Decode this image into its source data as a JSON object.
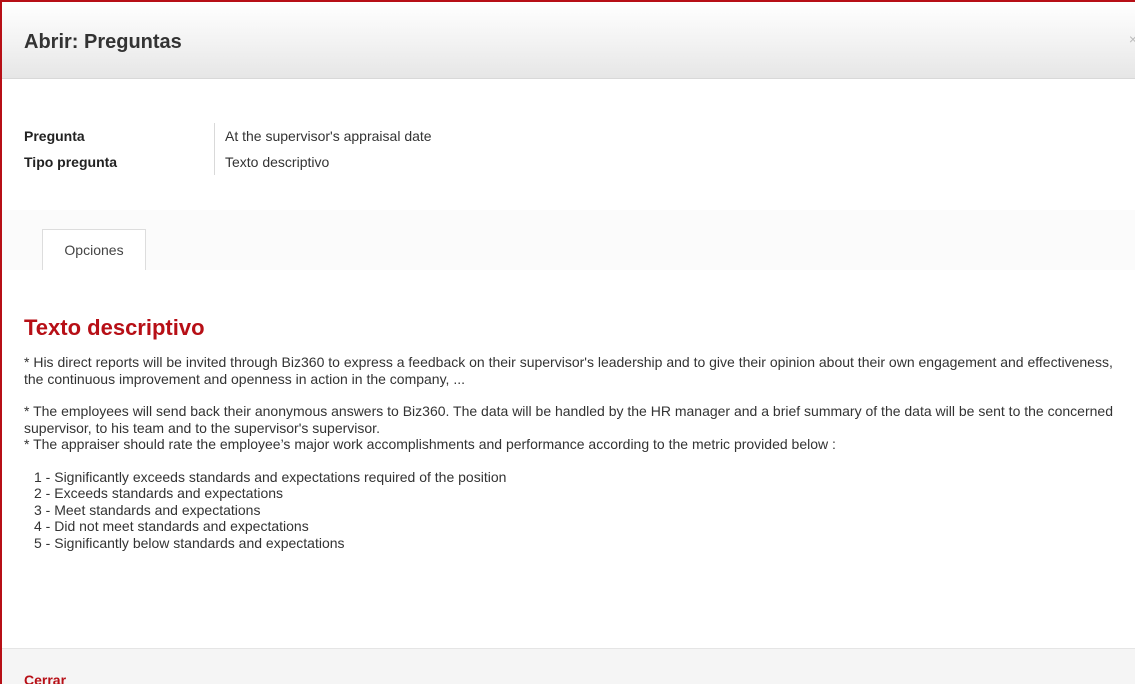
{
  "dialog": {
    "title": "Abrir: Preguntas",
    "close_glyph": "×",
    "close_icon": "close-icon"
  },
  "details": {
    "question_label": "Pregunta",
    "question_value": "At the supervisor's appraisal date",
    "type_label": "Tipo pregunta",
    "type_value": "Texto descriptivo"
  },
  "tabs": [
    {
      "label": "Opciones"
    }
  ],
  "content": {
    "heading": "Texto descriptivo",
    "paragraph_1": "* His direct reports will be invited through Biz360 to express a feedback on their supervisor's leadership and to give their opinion about their own engagement and effectiveness, the continuous improvement and openness in action in the company, ...",
    "paragraph_2": "* The employees will send back their anonymous answers to Biz360. The data will be handled by the HR manager and a brief summary of the data will be sent to the concerned supervisor, to his team and to the supervisor's supervisor.",
    "paragraph_3": "* The appraiser should rate the employee’s major work accomplishments and performance according to the metric provided below :",
    "scale": [
      "1 - Significantly exceeds standards and expectations required of the position",
      "2 - Exceeds standards and expectations",
      "3 - Meet standards and expectations",
      "4 - Did not meet standards and expectations",
      "5 - Significantly below standards and expectations"
    ]
  },
  "footer": {
    "close_label": "Cerrar"
  },
  "colors": {
    "accent": "#b70f16",
    "text": "#333333",
    "header_bg": "#eeeeee",
    "footer_bg": "#f5f5f5"
  }
}
